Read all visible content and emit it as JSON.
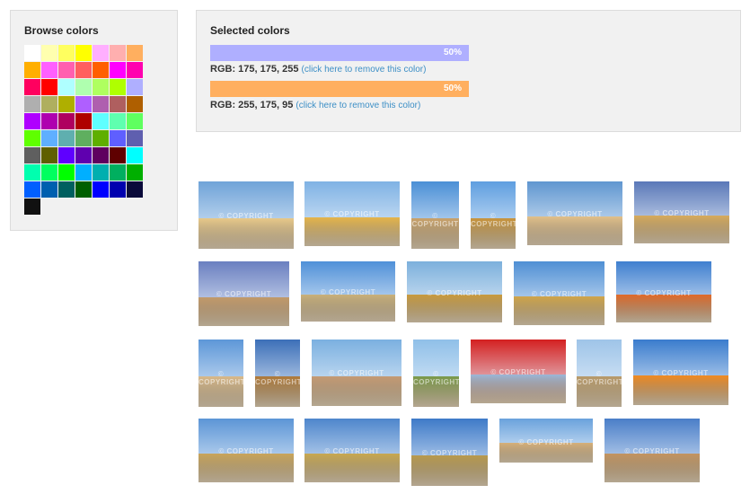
{
  "browse": {
    "title": "Browse colors",
    "swatches": [
      "#ffffff",
      "#ffffaf",
      "#ffff5f",
      "#ffff00",
      "#ffafff",
      "#ffafaf",
      "#ffaf5f",
      "#ffaf00",
      "#ff5fff",
      "#ff5faf",
      "#ff5f5f",
      "#ff5f00",
      "#ff00ff",
      "#ff00af",
      "#ff005f",
      "#ff0000",
      "#afffff",
      "#afffaf",
      "#afff5f",
      "#afff00",
      "#afafff",
      "#afafaf",
      "#afaf5f",
      "#afaf00",
      "#af5fff",
      "#af5faf",
      "#af5f5f",
      "#af5f00",
      "#af00ff",
      "#af00af",
      "#af005f",
      "#af0000",
      "#5fffff",
      "#5fffaf",
      "#5fff5f",
      "#5fff00",
      "#5fafff",
      "#5fafaf",
      "#5faf5f",
      "#5faf00",
      "#5f5fff",
      "#5f5faf",
      "#5f5f5f",
      "#5f5f00",
      "#5f00ff",
      "#5f00af",
      "#5f005f",
      "#5f0000",
      "#00ffff",
      "#00ffaf",
      "#00ff5f",
      "#00ff00",
      "#00afff",
      "#00afaf",
      "#00af5f",
      "#00af00",
      "#005fff",
      "#005faf",
      "#005f5f",
      "#005f00",
      "#0000ff",
      "#0000af",
      "#0a0a3a",
      "#111111"
    ]
  },
  "selected": {
    "title": "Selected colors",
    "items": [
      {
        "color": "#afafff",
        "percent": "50%",
        "rgb_label": "RGB: 175, 175, 255",
        "remove_label": "(click here to remove this color)"
      },
      {
        "color": "#ffaf5f",
        "percent": "50%",
        "rgb_label": "RGB: 255, 175, 95",
        "remove_label": "(click here to remove this color)"
      }
    ]
  },
  "watermark": "© COPYRIGHT",
  "images": [
    {
      "name": "beach-sand-photo",
      "sky": "#6fa3d8",
      "ground": "#e8c98a"
    },
    {
      "name": "desert-jeep-photo",
      "sky": "#7fb2e4",
      "ground": "#e5b54a"
    },
    {
      "name": "dinosaur-sculpture-photo",
      "sky": "#4a8fd6",
      "ground": "#c9a26a"
    },
    {
      "name": "temple-spires-photo",
      "sky": "#5e9ee0",
      "ground": "#c8943c"
    },
    {
      "name": "sand-snowman-photo",
      "sky": "#5f96d0",
      "ground": "#e2c08a"
    },
    {
      "name": "desert-dunes-photo",
      "sky": "#5a78b8",
      "ground": "#d6ab5c"
    },
    {
      "name": "pyramids-photo",
      "sky": "#6a7fc0",
      "ground": "#c29a6a"
    },
    {
      "name": "hay-bale-jump-photo",
      "sky": "#4f90d8",
      "ground": "#c9b07a"
    },
    {
      "name": "wheat-field-photo",
      "sky": "#7cb0dc",
      "ground": "#c89a3e"
    },
    {
      "name": "wheat-closeup-photo",
      "sky": "#4f8fd4",
      "ground": "#d0a54a"
    },
    {
      "name": "boy-pointing-photo",
      "sky": "#3f7fcf",
      "ground": "#e06a2a"
    },
    {
      "name": "pyramid-closeup-photo",
      "sky": "#5d97d8",
      "ground": "#d9b98a"
    },
    {
      "name": "golden-temple-photo",
      "sky": "#3c6fb8",
      "ground": "#b07a3a"
    },
    {
      "name": "camel-photo",
      "sky": "#7bb0e0",
      "ground": "#c59a74"
    },
    {
      "name": "monument-lawn-photo",
      "sky": "#8fbfe8",
      "ground": "#7a9a4a"
    },
    {
      "name": "red-frame-photo",
      "sky": "#d42020",
      "ground": "#9ab6d8"
    },
    {
      "name": "watchtower-photo",
      "sky": "#9ec4e8",
      "ground": "#b89a6a"
    },
    {
      "name": "piggy-bank-photo",
      "sky": "#3a7ccd",
      "ground": "#f08a22"
    },
    {
      "name": "man-wheat-field-photo",
      "sky": "#5c95d6",
      "ground": "#c9a55a"
    },
    {
      "name": "savanna-photo",
      "sky": "#4e86cc",
      "ground": "#c8a850"
    },
    {
      "name": "field-road-photo",
      "sky": "#3e7ac8",
      "ground": "#b89a4e"
    },
    {
      "name": "camel-caravan-photo",
      "sky": "#6aa2dc",
      "ground": "#d6b07a"
    },
    {
      "name": "giza-pyramid-photo",
      "sky": "#4a7ec8",
      "ground": "#c39460"
    }
  ]
}
